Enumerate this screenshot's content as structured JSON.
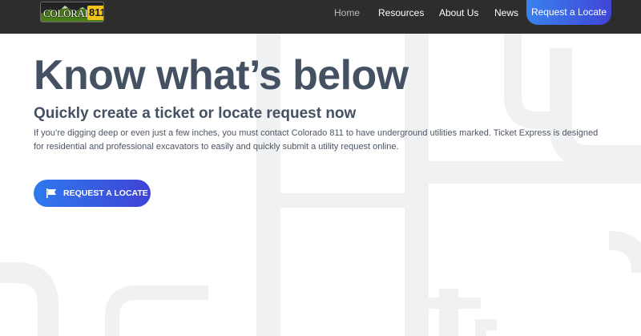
{
  "brand": {
    "logo_text": "COLORADO",
    "logo_number": "811"
  },
  "nav": {
    "items": [
      {
        "label": "Home",
        "active": true
      },
      {
        "label": "Resources",
        "active": false
      },
      {
        "label": "About Us",
        "active": false
      },
      {
        "label": "News",
        "active": false
      }
    ],
    "cta_label": "Request a Locate"
  },
  "hero": {
    "title": "Know what’s below",
    "subtitle": "Quickly create a ticket or locate request now",
    "description": "If you’re digging deep or even just a few inches, you must contact Colorado 811 to have underground utilities marked. Ticket Express is designed for residential and professional excavators to easily and quickly submit a utility request online.",
    "button_label": "REQUEST A LOCATE",
    "button_icon": "flag-icon"
  },
  "colors": {
    "nav_background": "#2d2d2d",
    "accent_start": "#2f79ee",
    "accent_end": "#3f43d5",
    "heading": "#445162",
    "body_text": "#4c5563",
    "pipe_pattern": "#f0f1f3"
  }
}
